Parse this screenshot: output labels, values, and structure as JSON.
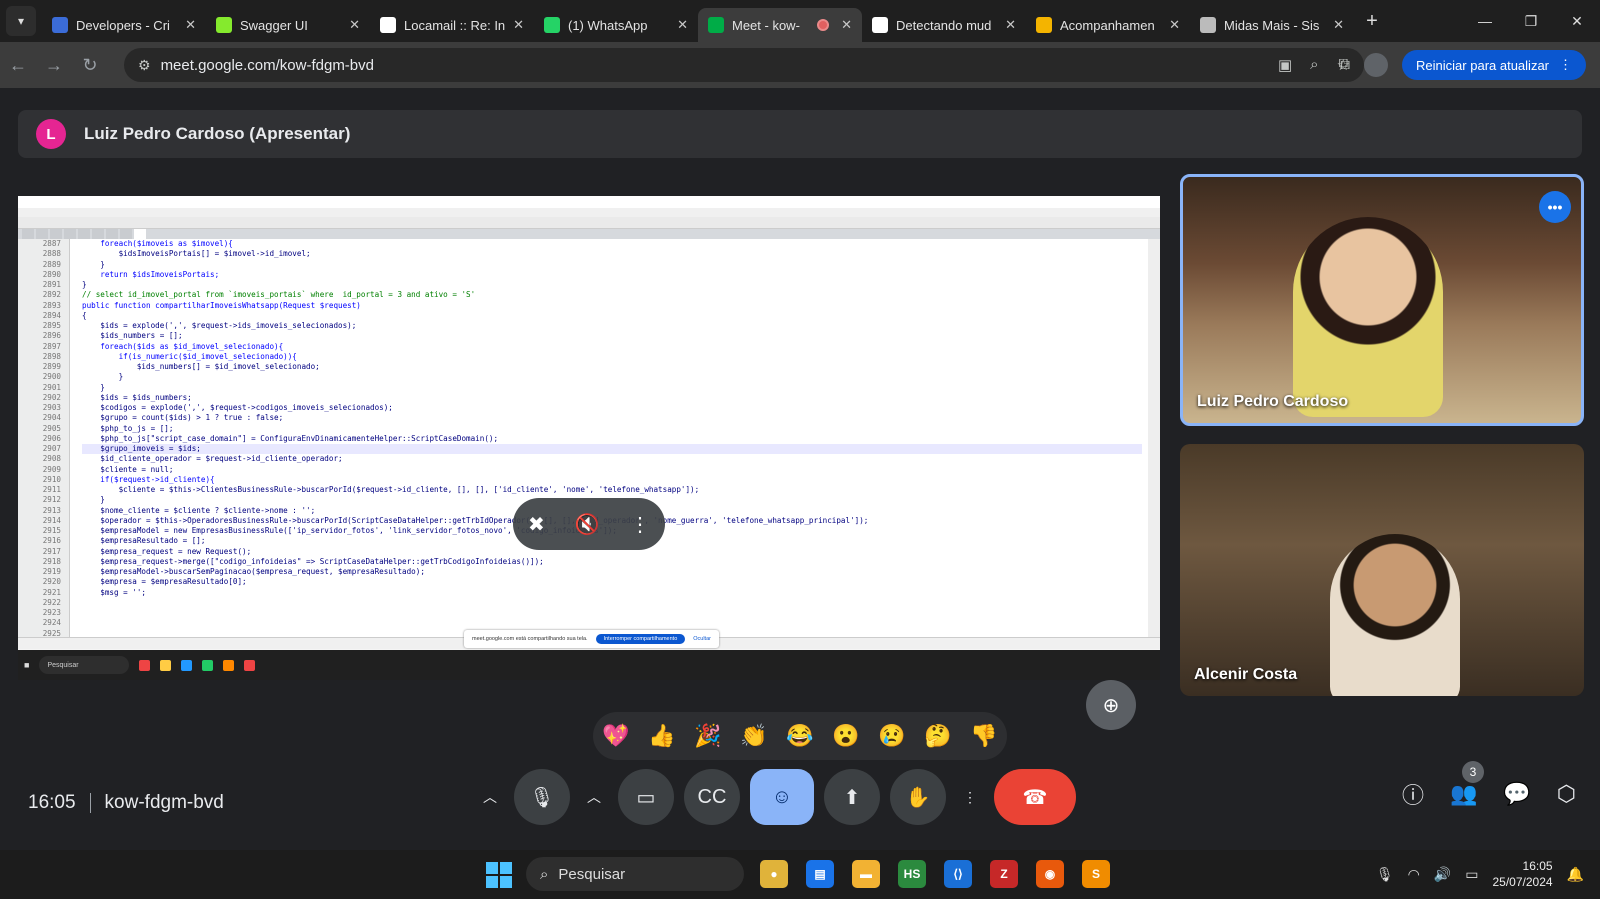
{
  "tabs": [
    {
      "title": "Developers - Cri",
      "favicon_color": "#3b6cd8"
    },
    {
      "title": "Swagger UI",
      "favicon_color": "#85ea2d"
    },
    {
      "title": "Locamail :: Re: In",
      "favicon_color": "#ffffff"
    },
    {
      "title": "(1) WhatsApp",
      "favicon_color": "#25d366"
    },
    {
      "title": "Meet - kow-",
      "favicon_color": "#00ac47",
      "active": true
    },
    {
      "title": "Detectando mud",
      "favicon_color": "#ffffff"
    },
    {
      "title": "Acompanhamen",
      "favicon_color": "#f4b400"
    },
    {
      "title": "Midas Mais - Sis",
      "favicon_color": "#bbbbbb"
    }
  ],
  "address": {
    "url": "meet.google.com/kow-fdgm-bvd",
    "update_button": "Reiniciar para atualizar"
  },
  "presenting": {
    "avatar_letter": "L",
    "title": "Luiz Pedro Cardoso (Apresentar)"
  },
  "shared_screen": {
    "code_lines": [
      {
        "n": "2887",
        "t": "    foreach($imoveis as $imovel){",
        "c": "kw"
      },
      {
        "n": "2888",
        "t": "        $idsImoveisPortais[] = $imovel->id_imovel;",
        "c": ""
      },
      {
        "n": "2889",
        "t": "    }",
        "c": ""
      },
      {
        "n": "2890",
        "t": "    return $idsImoveisPortais;",
        "c": "kw"
      },
      {
        "n": "2891",
        "t": "}",
        "c": ""
      },
      {
        "n": "2892",
        "t": "// select id_imovel_portal from `imoveis_portais` where  id_portal = 3 and ativo = 'S'",
        "c": "cm"
      },
      {
        "n": "2893",
        "t": "public function compartilharImoveisWhatsapp(Request $request)",
        "c": "kw"
      },
      {
        "n": "2894",
        "t": "{",
        "c": ""
      },
      {
        "n": "2895",
        "t": "    $ids = explode(',', $request->ids_imoveis_selecionados);",
        "c": ""
      },
      {
        "n": "2896",
        "t": "    $ids_numbers = [];",
        "c": ""
      },
      {
        "n": "2897",
        "t": "    foreach($ids as $id_imovel_selecionado){",
        "c": "kw"
      },
      {
        "n": "2898",
        "t": "        if(is_numeric($id_imovel_selecionado)){",
        "c": "kw"
      },
      {
        "n": "2899",
        "t": "            $ids_numbers[] = $id_imovel_selecionado;",
        "c": ""
      },
      {
        "n": "2900",
        "t": "        }",
        "c": ""
      },
      {
        "n": "2901",
        "t": "    }",
        "c": ""
      },
      {
        "n": "2902",
        "t": "    $ids = $ids_numbers;",
        "c": ""
      },
      {
        "n": "2903",
        "t": "    $codigos = explode(',', $request->codigos_imoveis_selecionados);",
        "c": ""
      },
      {
        "n": "2904",
        "t": "",
        "c": ""
      },
      {
        "n": "2905",
        "t": "    $grupo = count($ids) > 1 ? true : false;",
        "c": ""
      },
      {
        "n": "2906",
        "t": "    $php_to_js = [];",
        "c": ""
      },
      {
        "n": "2907",
        "t": "    $php_to_js[\"script_case_domain\"] = ConfiguraEnvDinamicamenteHelper::ScriptCaseDomain();",
        "c": ""
      },
      {
        "n": "2908",
        "t": "    $grupo_imoveis = $ids;",
        "c": "hl"
      },
      {
        "n": "2909",
        "t": "    $id_cliente_operador = $request->id_cliente_operador;",
        "c": ""
      },
      {
        "n": "2910",
        "t": "    $cliente = null;",
        "c": ""
      },
      {
        "n": "2911",
        "t": "",
        "c": ""
      },
      {
        "n": "2912",
        "t": "    if($request->id_cliente){",
        "c": "kw"
      },
      {
        "n": "2913",
        "t": "        $cliente = $this->ClientesBusinessRule->buscarPorId($request->id_cliente, [], [], ['id_cliente', 'nome', 'telefone_whatsapp']);",
        "c": ""
      },
      {
        "n": "2914",
        "t": "    }",
        "c": ""
      },
      {
        "n": "2915",
        "t": "    $nome_cliente = $cliente ? $cliente->nome : '';",
        "c": ""
      },
      {
        "n": "2916",
        "t": "",
        "c": ""
      },
      {
        "n": "2917",
        "t": "    $operador = $this->OperadoresBusinessRule->buscarPorId(ScriptCaseDataHelper::getTrbIdOperador(), [], [], ['id_operador', 'nome_guerra', 'telefone_whatsapp_principal']);",
        "c": ""
      },
      {
        "n": "2918",
        "t": "",
        "c": ""
      },
      {
        "n": "2919",
        "t": "    $empresaModel = new EmpresasBusinessRule(['ip_servidor_fotos', 'link_servidor_fotos_novo', 'codigo_infoideias']);",
        "c": ""
      },
      {
        "n": "2920",
        "t": "    $empresaResultado = [];",
        "c": ""
      },
      {
        "n": "2921",
        "t": "    $empresa_request = new Request();",
        "c": ""
      },
      {
        "n": "2922",
        "t": "    $empresa_request->merge([\"codigo_infoideias\" => ScriptCaseDataHelper::getTrbCodigoInfoideias()]);",
        "c": ""
      },
      {
        "n": "2923",
        "t": "    $empresaModel->buscarSemPaginacao($empresa_request, $empresaResultado);",
        "c": ""
      },
      {
        "n": "2924",
        "t": "    $empresa = $empresaResultado[0];",
        "c": ""
      },
      {
        "n": "2925",
        "t": "    $msg = '';",
        "c": ""
      }
    ],
    "share_notice": {
      "text": "meet.google.com está compartilhando sua tela.",
      "stop": "Interromper compartilhamento",
      "hide": "Ocultar"
    },
    "taskbar_search": "Pesquisar"
  },
  "participants": [
    {
      "name": "Luiz Pedro Cardoso"
    },
    {
      "name": "Alcenir Costa"
    }
  ],
  "reactions": [
    "💖",
    "👍",
    "🎉",
    "👏",
    "😂",
    "😮",
    "😢",
    "🤔",
    "👎"
  ],
  "bottom": {
    "time": "16:05",
    "meeting_code": "kow-fdgm-bvd",
    "participants_count": "3"
  },
  "taskbar": {
    "search": "Pesquisar",
    "time": "16:05",
    "date": "25/07/2024"
  }
}
